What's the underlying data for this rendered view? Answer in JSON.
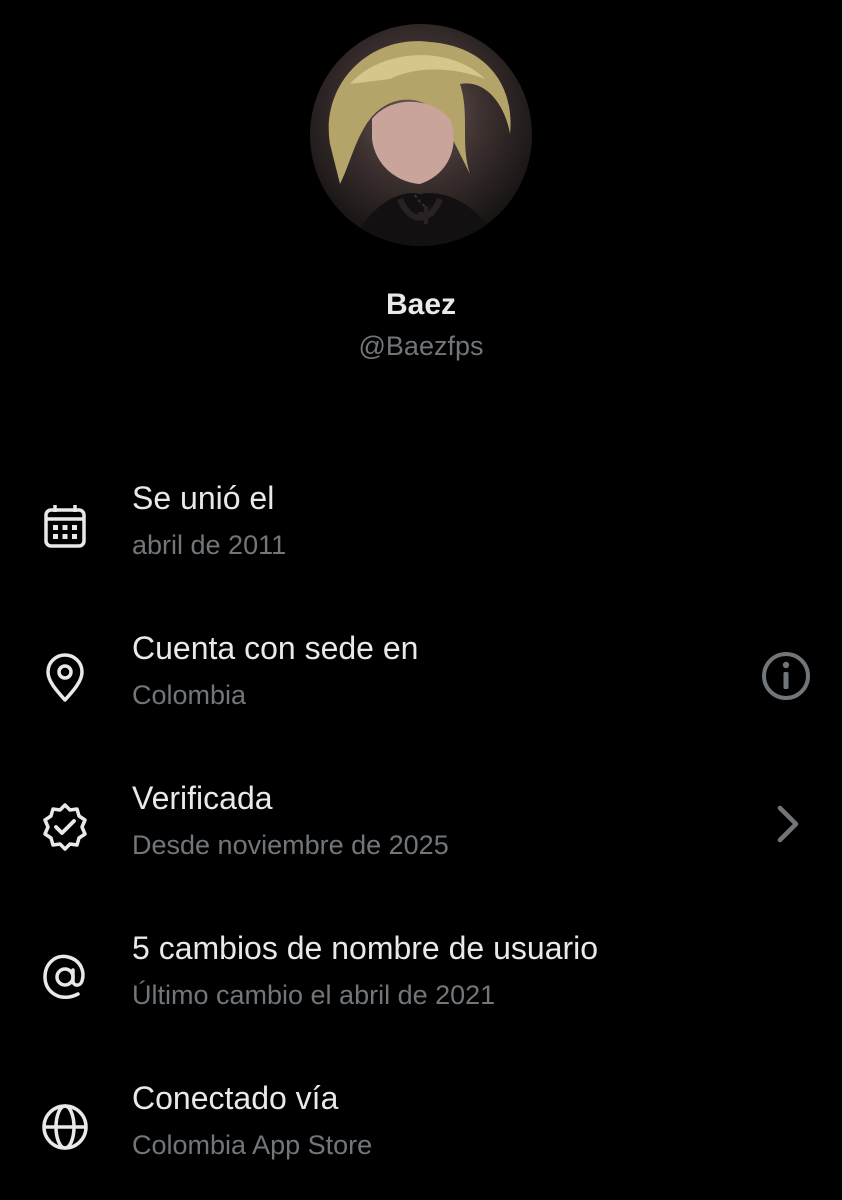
{
  "profile": {
    "display_name": "Baez",
    "handle": "@Baezfps",
    "avatar_icon": "profile-photo"
  },
  "details": [
    {
      "icon": "calendar-icon",
      "title": "Se unió el",
      "subtitle": "abril de 2011"
    },
    {
      "icon": "location-pin-icon",
      "title": "Cuenta con sede en",
      "subtitle": "Colombia",
      "trailing_icon": "info-icon"
    },
    {
      "icon": "verified-badge-icon",
      "title": "Verificada",
      "subtitle": "Desde noviembre de 2025",
      "trailing_icon": "chevron-right-icon"
    },
    {
      "icon": "at-sign-icon",
      "title": "5 cambios de nombre de usuario",
      "subtitle": "Último cambio el abril de 2021"
    },
    {
      "icon": "globe-icon",
      "title": "Conectado vía",
      "subtitle": "Colombia App Store"
    }
  ],
  "colors": {
    "background": "#000000",
    "primary_text": "#e7e9ea",
    "secondary_text": "#71767b"
  }
}
